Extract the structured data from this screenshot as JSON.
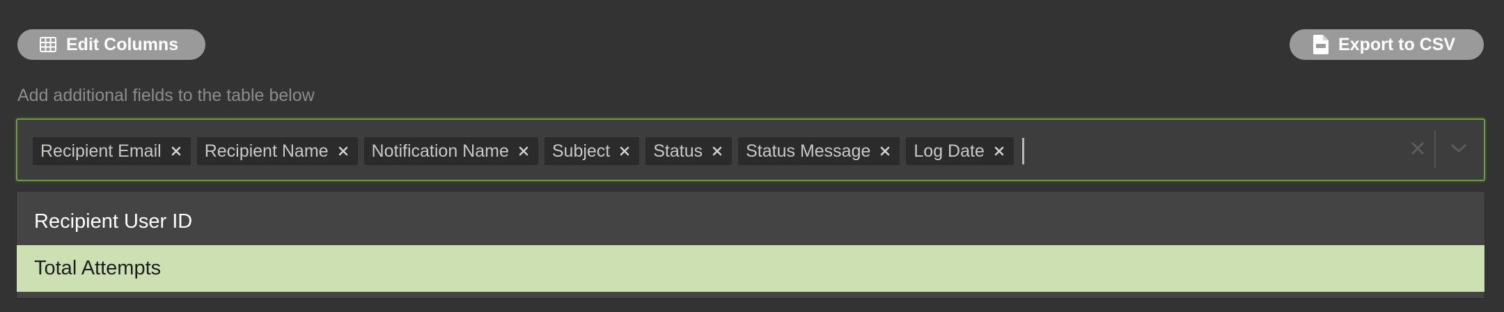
{
  "toolbar": {
    "edit_columns_label": "Edit Columns",
    "edit_columns_icon": "table-grid-icon",
    "export_label": "Export to CSV",
    "export_icon": "csv-file-icon"
  },
  "hint_text": "Add additional fields to the table below",
  "selected_fields": [
    "Recipient Email",
    "Recipient Name",
    "Notification Name",
    "Subject",
    "Status",
    "Status Message",
    "Log Date"
  ],
  "select_controls": {
    "clear_icon": "close-icon",
    "toggle_icon": "chevron-down-icon"
  },
  "dropdown_options": [
    "Recipient User ID",
    "Total Attempts"
  ],
  "highlighted_option": "Total Attempts",
  "colors": {
    "background": "#333333",
    "focus_border": "#6e9e3a",
    "highlight": "#cde0b2",
    "button_bg": "#9a9a9a",
    "tag_bg": "#2b2b2b"
  }
}
